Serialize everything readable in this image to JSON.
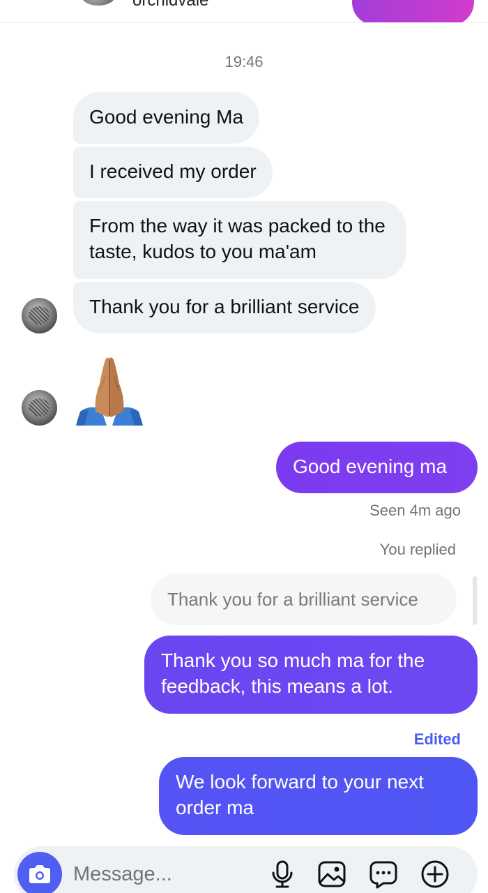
{
  "header": {
    "username": "orchidvale"
  },
  "thread": {
    "timestamp": "19:46",
    "incoming": [
      "Good evening Ma",
      "I received my order",
      "From the way it was packed to the taste, kudos to you ma'am",
      "Thank you for a brilliant service"
    ],
    "incoming_emoji": "🙏🏽",
    "outgoing_1": "Good evening ma",
    "seen_status": "Seen 4m ago",
    "you_replied": "You replied",
    "quoted_message": "Thank you for a brilliant service",
    "outgoing_2": "Thank you so much ma for the feedback, this means a lot.",
    "edited_label": "Edited",
    "outgoing_3": "We look forward to your next order ma"
  },
  "composer": {
    "placeholder": "Message...",
    "icons": [
      "camera-icon",
      "microphone-icon",
      "image-icon",
      "sticker-chat-icon",
      "plus-icon"
    ]
  },
  "colors": {
    "outgoing_purple": "#7b3af0",
    "outgoing_violet": "#6a46f1",
    "outgoing_blue": "#5453f3",
    "incoming_bg": "#eff2f5",
    "edited_blue": "#4a5cf0",
    "camera_blue": "#4e5ff2"
  }
}
